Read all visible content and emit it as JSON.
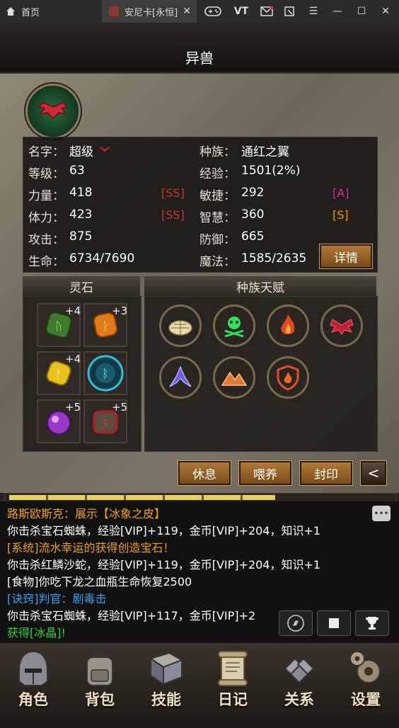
{
  "browser": {
    "home_tab": "首页",
    "game_tab": "安尼卡[永恒]",
    "vt_label": "VT"
  },
  "header": {
    "title": "异兽"
  },
  "stats": {
    "name_label": "名字：",
    "name": "超级",
    "race_label": "种族：",
    "race": "通红之翼",
    "level_label": "等级：",
    "level": "63",
    "exp_label": "经验：",
    "exp": "1501(2%)",
    "str_label": "力量：",
    "str": "418",
    "str_grade": "[SS]",
    "agi_label": "敏捷：",
    "agi": "292",
    "agi_grade": "[A]",
    "con_label": "体力：",
    "con": "423",
    "con_grade": "[SS]",
    "wis_label": "智慧：",
    "wis": "360",
    "wis_grade": "[S]",
    "atk_label": "攻击：",
    "atk": "875",
    "def_label": "防御：",
    "def": "665",
    "hp_label": "生命：",
    "hp": "6734/7690",
    "mp_label": "魔法：",
    "mp": "1585/2635",
    "details_button": "详情"
  },
  "spirit_stones": {
    "title": "灵石",
    "slots": [
      {
        "plus": "+4",
        "icon": "green-rune-gem"
      },
      {
        "plus": "+3",
        "icon": "orange-rune-gem"
      },
      {
        "plus": "+4",
        "icon": "gold-rune-gem"
      },
      {
        "plus": "",
        "icon": "cyan-rune-orb"
      },
      {
        "plus": "+5",
        "icon": "purple-orb"
      },
      {
        "plus": "+5",
        "icon": "red-rune-stone"
      }
    ]
  },
  "race_talents": {
    "title": "种族天赋",
    "icons": [
      "shell-icon",
      "poison-skull-icon",
      "fire-icon",
      "red-wings-icon",
      "blue-wings-icon",
      "mountain-icon",
      "fire-shield-icon"
    ]
  },
  "actions": {
    "rest": "休息",
    "feed": "喂养",
    "seal": "封印",
    "collapse": "<"
  },
  "chat": {
    "lines": [
      {
        "text": "路斯欧斯克：展示【冰象之皮】",
        "color": "#f0a020"
      },
      {
        "text": "你击杀宝石蜘蛛，经验[VIP]+119，金币[VIP]+204，知识+1",
        "color": "#ffffff"
      },
      {
        "text": "[系统]流水幸运的获得创造宝石！",
        "color": "#f0a020"
      },
      {
        "text": "你击杀红鳞沙蛇，经验[VIP]+119，金币[VIP]+204，知识+1",
        "color": "#ffffff"
      },
      {
        "text": "[食物]你吃下龙之血瓶生命恢复2500",
        "color": "#ffffff"
      },
      {
        "text": "[诀窍]判官：剧毒击",
        "color": "#3aa0f0"
      },
      {
        "text": "你击杀宝石蜘蛛，经验[VIP]+117，金币[VIP]+2",
        "color": "#ffffff"
      },
      {
        "text": "获得[冰晶]!",
        "color": "#30d040"
      }
    ]
  },
  "nav": {
    "items": [
      {
        "label": "角色",
        "icon": "helmet-icon"
      },
      {
        "label": "背包",
        "icon": "backpack-icon"
      },
      {
        "label": "技能",
        "icon": "skill-book-icon"
      },
      {
        "label": "日记",
        "icon": "scroll-icon"
      },
      {
        "label": "关系",
        "icon": "gauntlets-icon"
      },
      {
        "label": "设置",
        "icon": "gear-icon"
      }
    ]
  }
}
